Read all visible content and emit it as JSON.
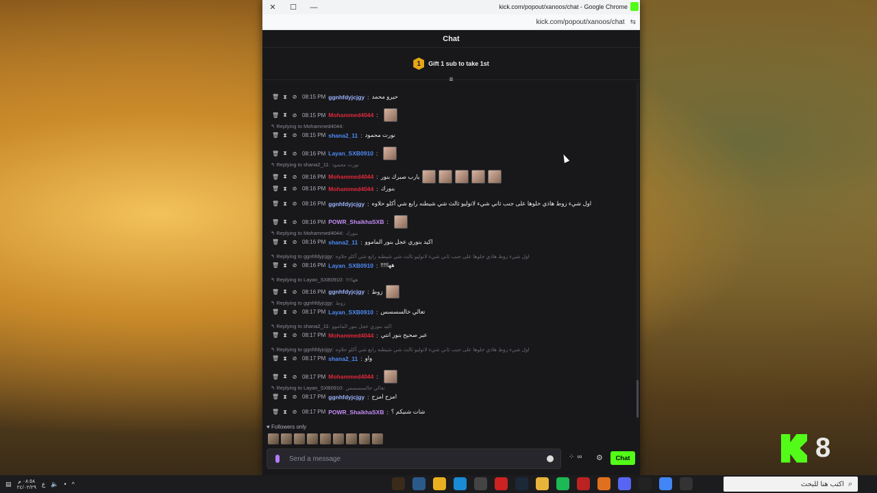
{
  "window": {
    "title": "kick.com/popout/xanoos/chat - Google Chrome",
    "url": "kick.com/popout/xanoos/chat"
  },
  "chat": {
    "header": "Chat",
    "gift": {
      "rank": "1",
      "text": "Gift 1 sub to take 1st"
    },
    "messages": [
      {
        "time": "08:15 PM",
        "user": "ggnhfdyjcjgy",
        "color": "#9db4ff",
        "text": "حيرو محمد",
        "emotes": 0
      },
      {
        "time": "08:15 PM",
        "user": "Mohammed4044",
        "color": "#e0283a",
        "text": "",
        "emotes": 1
      },
      {
        "reply_to": "Replying to Mohammed4044:",
        "quote": "",
        "time": "08:15 PM",
        "user": "shana2_11",
        "color": "#4d8cf5",
        "text": "نورت محمود",
        "emotes": 0
      },
      {
        "time": "08:16 PM",
        "user": "Layan_SXB0910",
        "color": "#4d8cf5",
        "text": "",
        "emotes": 1
      },
      {
        "reply_to": "Replying to shana2_11:",
        "quote": "نورت محمود",
        "time": "08:16 PM",
        "user": "Mohammed4044",
        "color": "#e0283a",
        "text": "يارب صبرك بنور",
        "emotes": 5
      },
      {
        "time": "08:16 PM",
        "user": "Mohammed4044",
        "color": "#e0283a",
        "text": "بنورك",
        "emotes": 0
      },
      {
        "time": "08:16 PM",
        "user": "ggnhfdyjcjgy",
        "color": "#9db4ff",
        "text": "اول شيء زوط هاذي خلوها على جنب ثاني شيء لاتوليو ثالث شي شيطنه رابع شي أكلو حلاوه",
        "emotes": 0
      },
      {
        "time": "08:16 PM",
        "user": "POWR_ShaikhaSXB",
        "color": "#c48cf5",
        "text": "",
        "emotes": 1
      },
      {
        "reply_to": "Replying to Mohammed4044:",
        "quote": "بنورك",
        "time": "08:16 PM",
        "user": "shana2_11",
        "color": "#4d8cf5",
        "text": "اكيد بنوري عجل بنور الماموو",
        "emotes": 0
      },
      {
        "reply_to": "Replying to ggnhfdyjcjgy:",
        "quote": "اول شيء زوط هاذي خلوها على جنب ثاني شيء لاتوليو ثالث شي شيطنه رابع شي أكلو حلاوه",
        "time": "08:16 PM",
        "user": "Layan_SXB0910",
        "color": "#4d8cf5",
        "text": "!!!!هها",
        "emotes": 0
      },
      {
        "reply_to": "Replying to Layan_SXB0910:",
        "quote": "!!!!هها",
        "time": "08:16 PM",
        "user": "ggnhfdyjcjgy",
        "color": "#9db4ff",
        "text": "زوط",
        "emotes": 1
      },
      {
        "reply_to": "Replying to ggnhfdyjcjgy:",
        "quote": "زوط",
        "time": "08:17 PM",
        "user": "Layan_SXB0910",
        "color": "#4d8cf5",
        "text": "تعالي خالسسسس",
        "emotes": 0
      },
      {
        "reply_to": "Replying to shana2_11:",
        "quote": "اكيد بنوري عجل بنور الماموو",
        "time": "08:17 PM",
        "user": "Mohammed4044",
        "color": "#e0283a",
        "text": "عبر صحيح بنور انتي",
        "emotes": 0
      },
      {
        "reply_to": "Replying to ggnhfdyjcjgy:",
        "quote": "اول شيء زوط هاذي خلوها على جنب ثاني شيء لاتوليو ثالث شي شيطنه رابع شي أكلو حلاوه",
        "time": "08:17 PM",
        "user": "shana2_11",
        "color": "#4d8cf5",
        "text": "واو",
        "emotes": 0
      },
      {
        "time": "08:17 PM",
        "user": "Mohammed4044",
        "color": "#e0283a",
        "text": "",
        "emotes": 1
      },
      {
        "reply_to": "Replying to Layan_SXB0910:",
        "quote": "تعالي خالسسسس",
        "time": "08:17 PM",
        "user": "ggnhfdyjcjgy",
        "color": "#9db4ff",
        "text": "امزح امزح",
        "emotes": 0
      },
      {
        "time": "08:17 PM",
        "user": "POWR_ShaikhaSXB",
        "color": "#c48cf5",
        "text": "شات شنيكم ؟",
        "emotes": 0
      }
    ],
    "followers_only": "Followers only",
    "input_placeholder": "Send a message",
    "send_label": "Chat"
  },
  "desktop": {
    "badge_number": "8"
  },
  "taskbar": {
    "time": "٠٨:٥٨ م",
    "date": "٢٤/٠٢/٢٩",
    "lang": "ع",
    "search_placeholder": "اكتب هنا للبحث"
  }
}
